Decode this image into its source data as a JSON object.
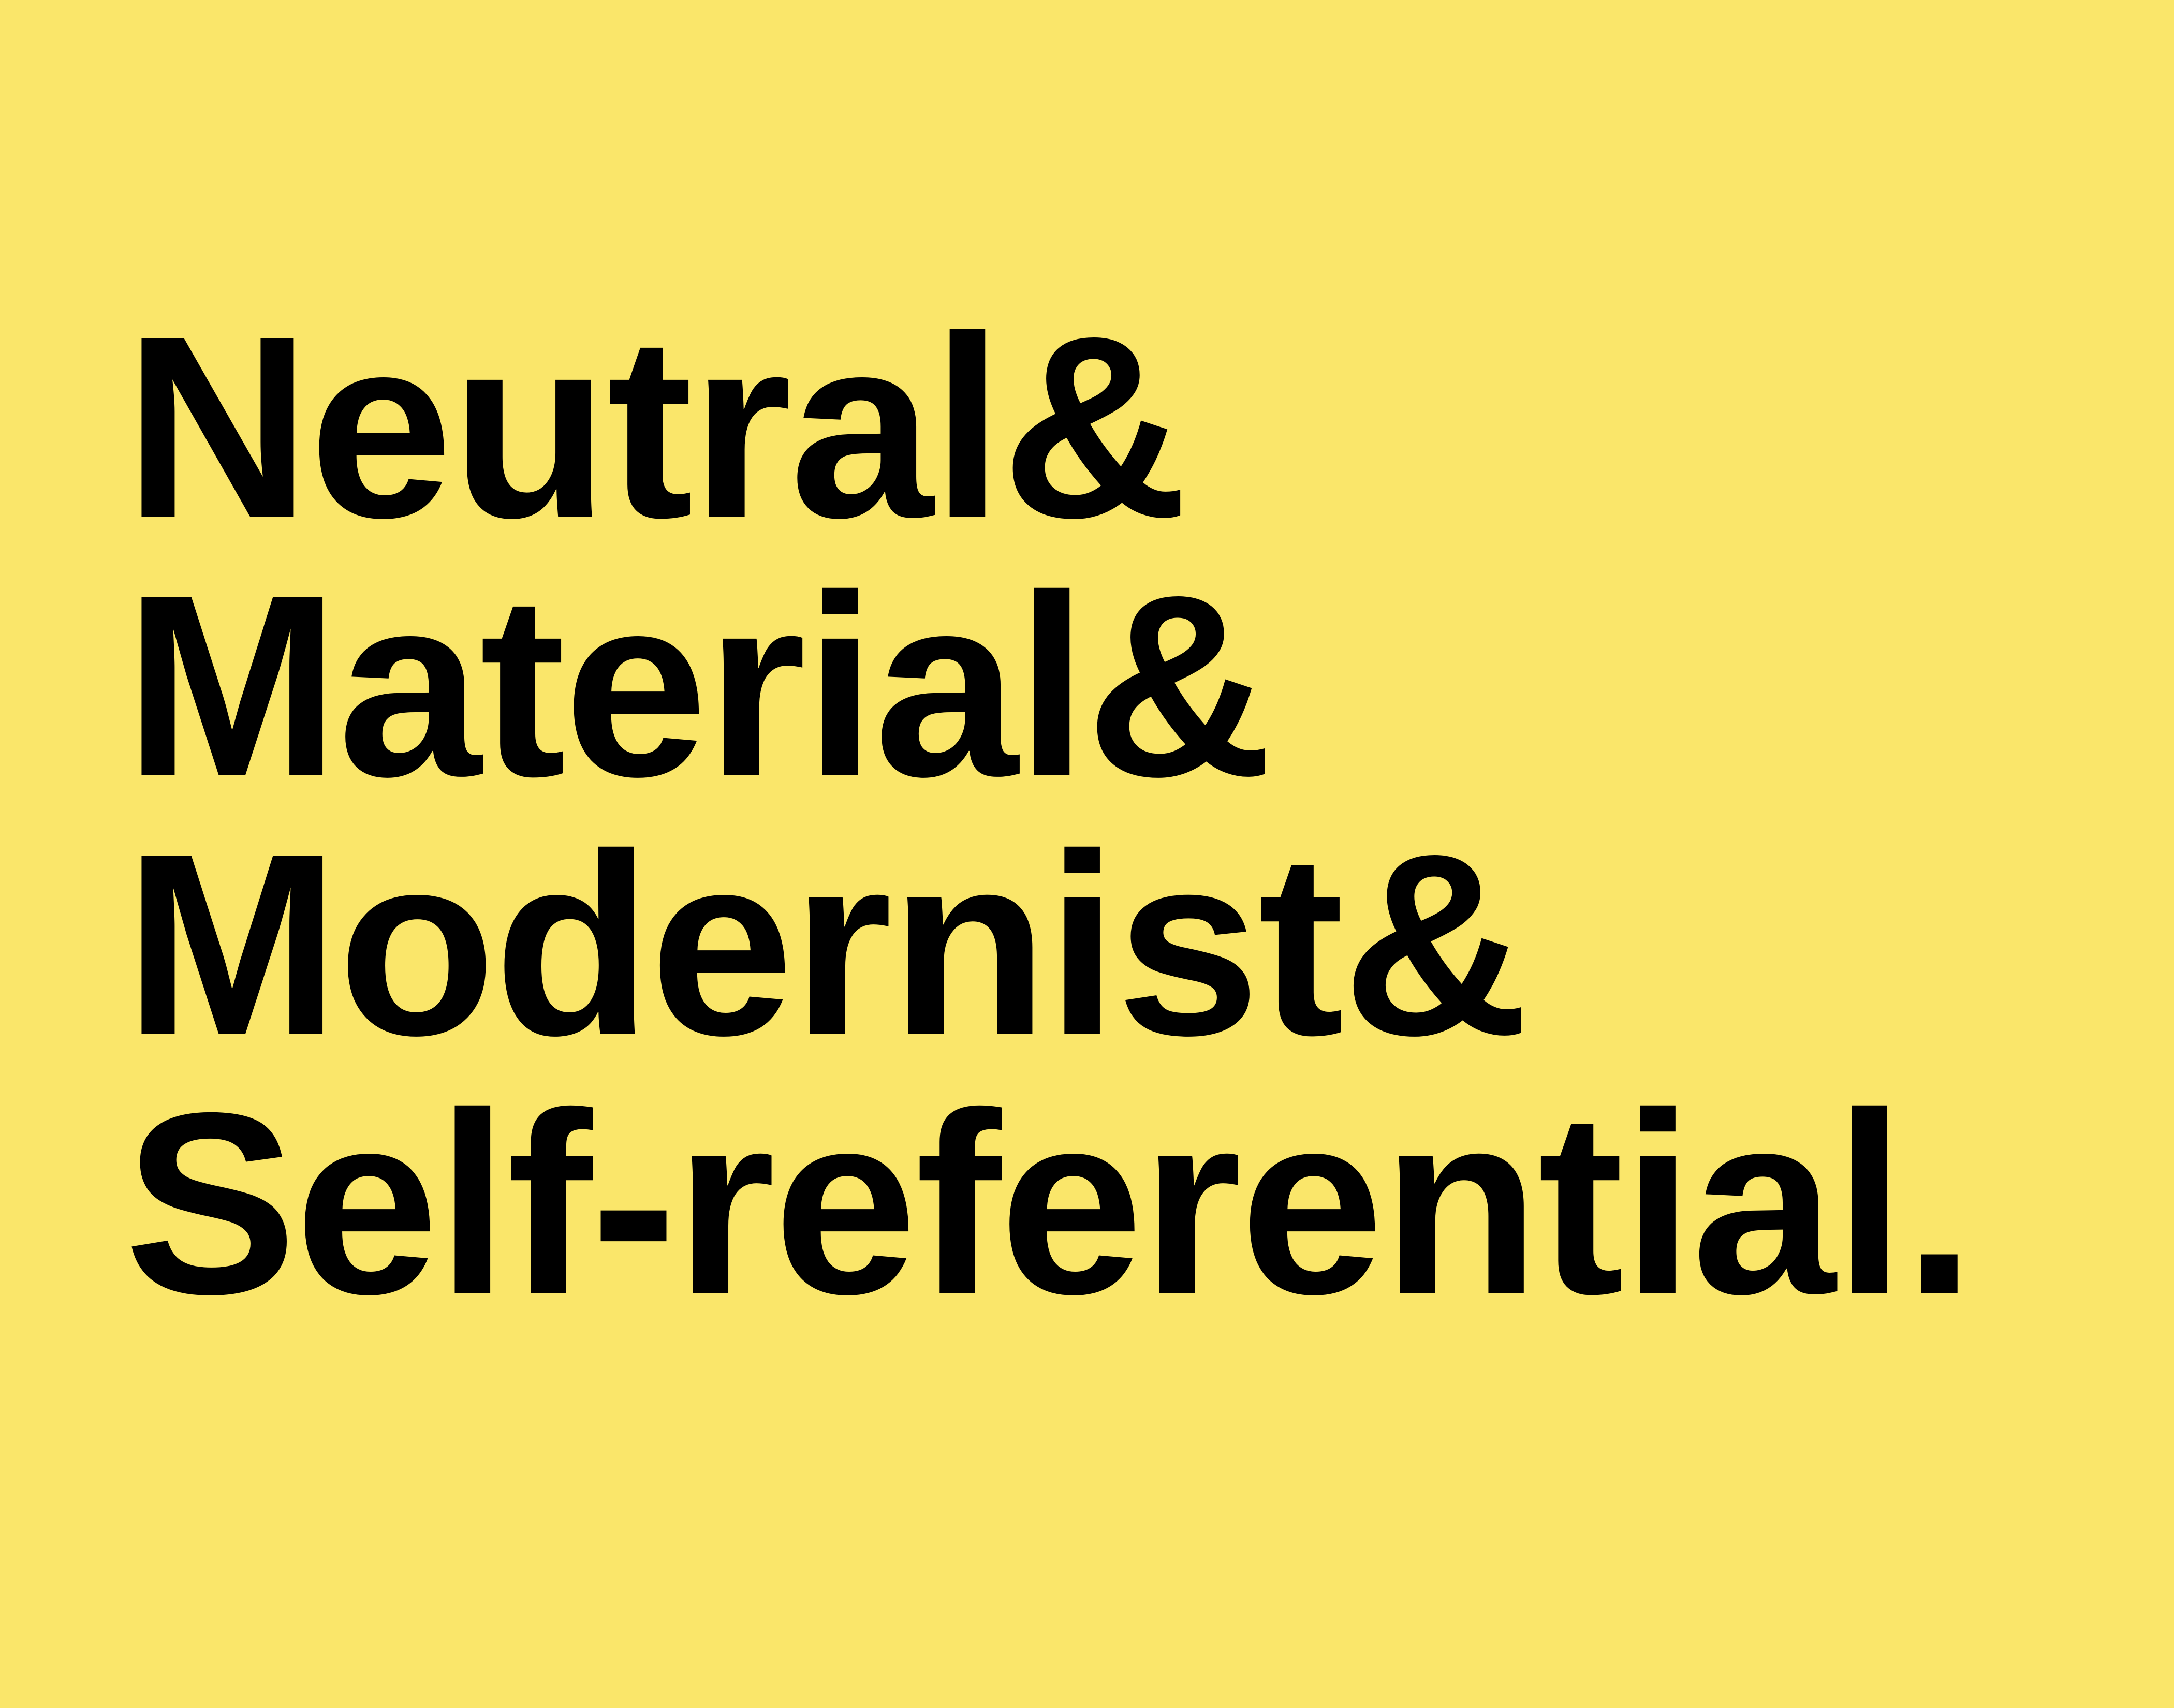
{
  "poster": {
    "background_color": "#FAE66A",
    "text_color": "#000000",
    "lines": [
      "Neutral&",
      "Material&",
      "Modernist&",
      "Self-referential."
    ]
  }
}
